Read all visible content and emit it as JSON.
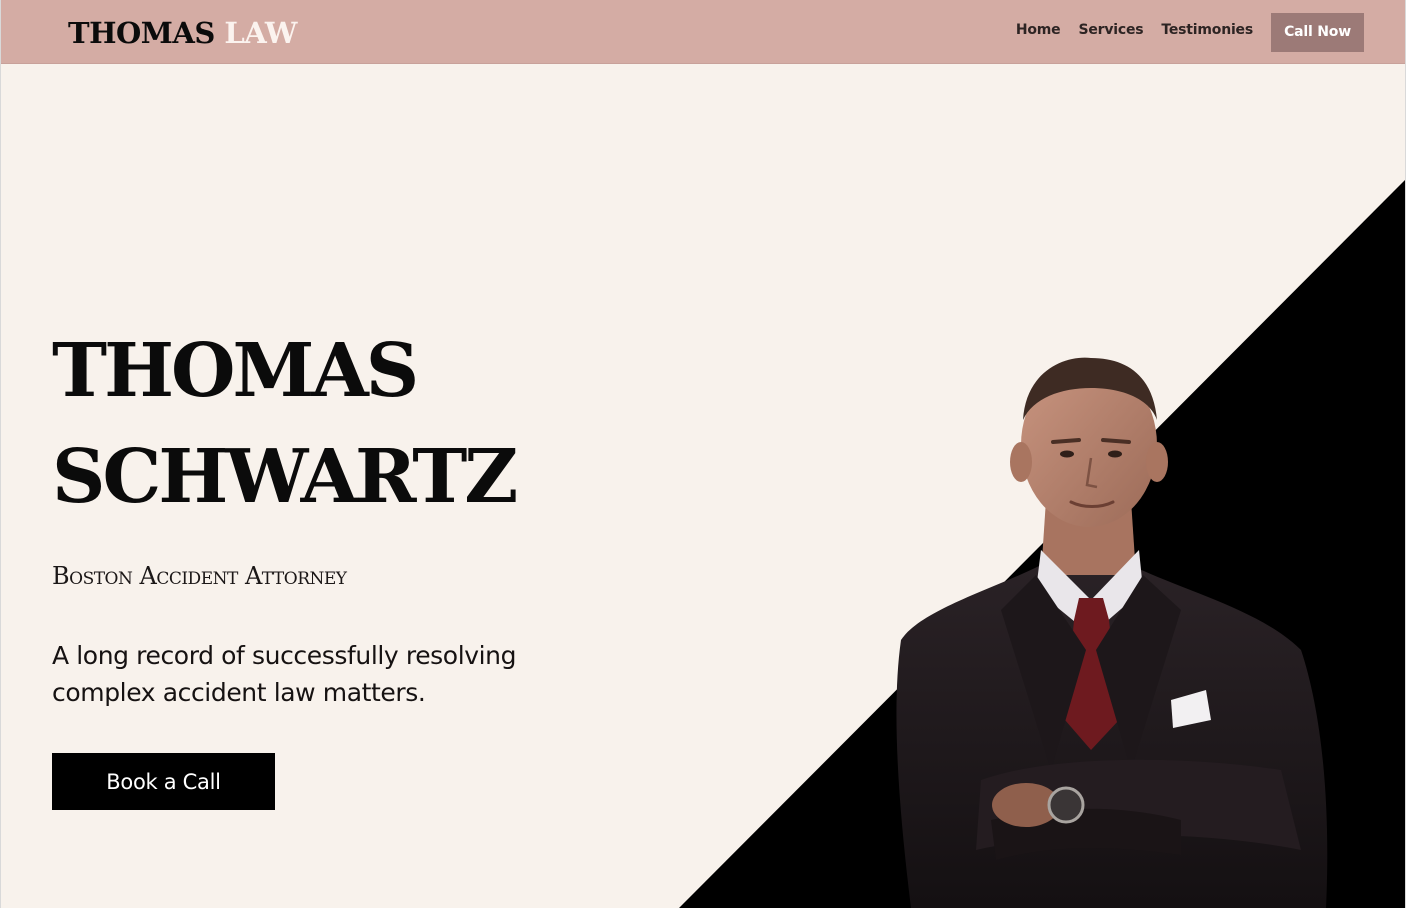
{
  "header": {
    "brand_part1": "THOMAS",
    "brand_part2": "LAW",
    "nav": [
      {
        "label": "Home"
      },
      {
        "label": "Services"
      },
      {
        "label": "Testimonies"
      }
    ],
    "cta_label": "Call Now"
  },
  "hero": {
    "title_line1": "THOMAS",
    "title_line2": "SCHWARTZ",
    "subtitle": "Boston Accident Attorney",
    "description": "A long record of successfully resolving complex accident law matters.",
    "cta_label": "Book a Call"
  },
  "colors": {
    "header_bg": "#d4aca4",
    "page_bg": "#f8f2ec",
    "accent_button": "#9c7a77",
    "text_dark": "#0b0b0b"
  },
  "icons": [
    "attorney-portrait-photo"
  ]
}
